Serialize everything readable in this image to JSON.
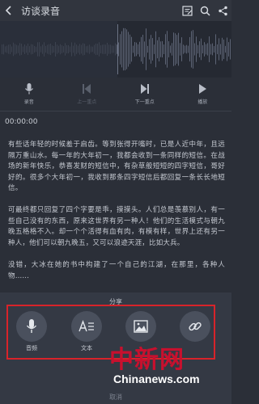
{
  "header": {
    "title": "访谈录音"
  },
  "controls": [
    {
      "label": "录音",
      "icon": "microphone-icon",
      "enabled": true
    },
    {
      "label": "上一重点",
      "icon": "previous-mark-icon",
      "enabled": false
    },
    {
      "label": "下一重点",
      "icon": "next-mark-icon",
      "enabled": true
    },
    {
      "label": "播放",
      "icon": "play-icon",
      "enabled": true
    }
  ],
  "playback": {
    "timestamp": "00:00:00",
    "progress": 0.5
  },
  "transcript": {
    "p1": "有些话年轻的时候羞于启齿。等到张得开嘴时，已是人近中年，且远隔万重山水。每一年的大年初一，我都会收到一条同样的短信。在战场的新年快乐，恭喜发财的短信中，有杂草般短短的四字短信，哥好好的。很多个大年初一，我收到那条四字短信后都回复一条长长地短信。",
    "p2": "可最终都只回复了四个字要是乖，摸摸头。人们总是羡慕别人，有一些自己没有的东西，原来这世界有另一种人！他们的生活模式与朝九晚五格格不入。却一个个活得有血有肉，有模有样，世界上还有另一种人，他们可以朝九晚五，又可以浪迹天涯，比如大兵。",
    "p3": "没错，大冰在她的书中构建了一个自己的江湖，在那里，各种人物……"
  },
  "share": {
    "title": "分享",
    "options": [
      {
        "label": "音频",
        "icon": "microphone-icon"
      },
      {
        "label": "文本",
        "icon": "text-icon"
      },
      {
        "label": "",
        "icon": "image-icon"
      },
      {
        "label": "",
        "icon": "link-icon"
      }
    ],
    "bottom_text": "取消"
  },
  "watermark": {
    "cn": "中新网",
    "en": "Chinanews.com"
  },
  "colors": {
    "background": "#2b2f38",
    "highlight_border": "#d8232a",
    "watermark_red": "#c8102e"
  }
}
